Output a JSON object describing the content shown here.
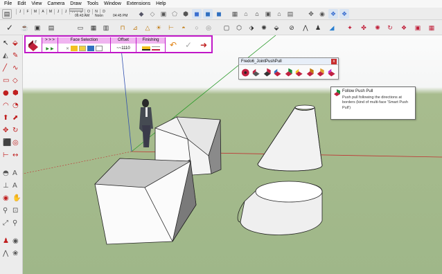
{
  "menu": [
    "File",
    "Edit",
    "View",
    "Camera",
    "Draw",
    "Tools",
    "Window",
    "Extensions",
    "Help"
  ],
  "shadows": {
    "months": [
      "J",
      "F",
      "M",
      "A",
      "M",
      "J",
      "J",
      "A",
      "S",
      "O",
      "N",
      "D"
    ],
    "time_start": "06:43 AM",
    "time_mid": "Noon",
    "time_end": "04:45 PM"
  },
  "fredo_toolbar": {
    "arrows_label": "> > >",
    "face_selection_label": "Face Selection",
    "offset_label": "Offset",
    "offset_value": "~~1110",
    "finishing_label": "Finishing"
  },
  "floating_toolbar": {
    "title": "Fredo6_JointPushPull",
    "close_label": "x"
  },
  "tooltip": {
    "title": "Follow Push Pull",
    "description": "Push pull following the directions at borders (kind of multi-face 'Smart Push Pull')"
  },
  "colors": {
    "accent_magenta": "#c018c8",
    "sky": "#f5f6f6",
    "ground": "#a3b88c",
    "axis_red": "#c03030",
    "axis_green": "#2a9a2a",
    "axis_blue": "#3050b0"
  }
}
